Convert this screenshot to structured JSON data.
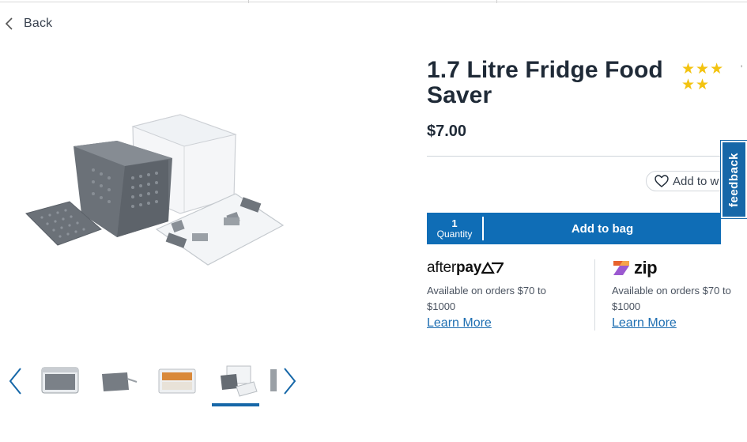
{
  "nav": {
    "back_label": "Back"
  },
  "product": {
    "title": "1.7 Litre Fridge Food Saver",
    "rating_stars": 5,
    "price": "$7.00"
  },
  "actions": {
    "wishlist_label": "Add to w",
    "quantity_value": "1",
    "quantity_label": "Quantity",
    "add_to_bag_label": "Add to bag"
  },
  "feedback": {
    "label": "feedback"
  },
  "payment": {
    "afterpay": {
      "brand_prefix": "after",
      "brand_suffix": "pay",
      "description": "Available on orders $70 to $1000",
      "learn_more": "Learn More"
    },
    "zip": {
      "brand": "zip",
      "description": "Available on orders $70 to $1000",
      "learn_more": "Learn More"
    }
  },
  "gallery": {
    "thumbnails": [
      "thumb-closed-container",
      "thumb-basket-side",
      "thumb-container-food",
      "thumb-container-open",
      "thumb-partial"
    ],
    "active_index": 3
  },
  "colors": {
    "brand_blue": "#0f6db6",
    "star_yellow": "#f3c310",
    "link_blue": "#1f6fb2",
    "text_dark": "#1f2a37"
  }
}
